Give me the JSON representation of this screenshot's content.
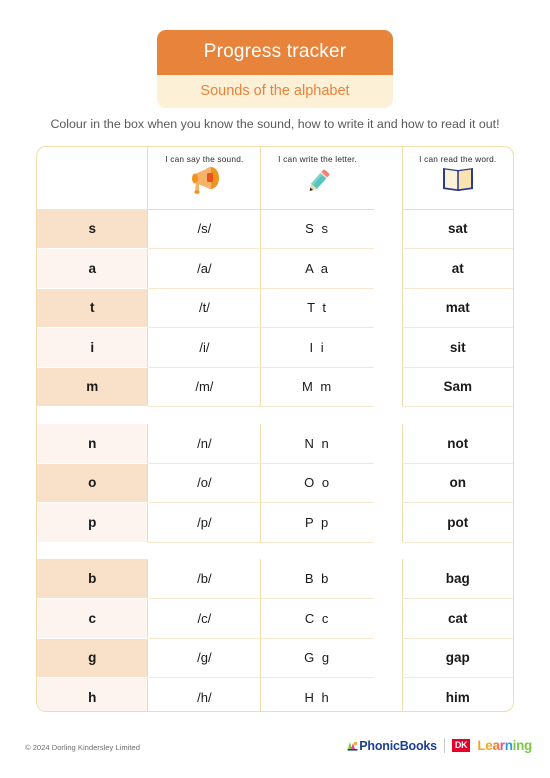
{
  "header": {
    "title": "Progress tracker",
    "subtitle": "Sounds of the alphabet",
    "title_bg": "#e8833c",
    "subtitle_bg": "#fcf0d7",
    "subtitle_color": "#e8833c"
  },
  "instruction": "Colour in the box when you know the sound, how to write it and how to read it out!",
  "table": {
    "columns": [
      {
        "key": "letter",
        "label": "",
        "icon": ""
      },
      {
        "key": "say",
        "label": "I can say the sound.",
        "icon": "megaphone-icon"
      },
      {
        "key": "write",
        "label": "I can write the letter.",
        "icon": "pencil-icon"
      },
      {
        "key": "read",
        "label": "I can read the word.",
        "icon": "open-book-icon"
      }
    ],
    "groups": [
      {
        "rows": [
          {
            "letter": "s",
            "say": "/s/",
            "write": "S s",
            "read": "sat"
          },
          {
            "letter": "a",
            "say": "/a/",
            "write": "A a",
            "read": "at"
          },
          {
            "letter": "t",
            "say": "/t/",
            "write": "T t",
            "read": "mat"
          },
          {
            "letter": "i",
            "say": "/i/",
            "write": "I i",
            "read": "sit"
          },
          {
            "letter": "m",
            "say": "/m/",
            "write": "M m",
            "read": "Sam"
          }
        ]
      },
      {
        "rows": [
          {
            "letter": "n",
            "say": "/n/",
            "write": "N n",
            "read": "not"
          },
          {
            "letter": "o",
            "say": "/o/",
            "write": "O o",
            "read": "on"
          },
          {
            "letter": "p",
            "say": "/p/",
            "write": "P p",
            "read": "pot"
          }
        ]
      },
      {
        "rows": [
          {
            "letter": "b",
            "say": "/b/",
            "write": "B b",
            "read": "bag"
          },
          {
            "letter": "c",
            "say": "/c/",
            "write": "C c",
            "read": "cat"
          },
          {
            "letter": "g",
            "say": "/g/",
            "write": "G g",
            "read": "gap"
          },
          {
            "letter": "h",
            "say": "/h/",
            "write": "H h",
            "read": "him"
          }
        ]
      }
    ],
    "border_color": "#f2dcae",
    "shade_dark": "#f8e0c9",
    "shade_light": "#fdf3ef"
  },
  "footer": {
    "copyright": "© 2024 Dorling Kindersley Limited",
    "phonicbooks_label": "PhonicBooks",
    "dk_badge": "DK",
    "learning_label": "Learning",
    "learning_letters": [
      {
        "ch": "L",
        "color": "#f5a623"
      },
      {
        "ch": "e",
        "color": "#f5a623"
      },
      {
        "ch": "a",
        "color": "#f07c35"
      },
      {
        "ch": "r",
        "color": "#ee4a8c"
      },
      {
        "ch": "n",
        "color": "#2a9fd6"
      },
      {
        "ch": "i",
        "color": "#7ac943"
      },
      {
        "ch": "n",
        "color": "#7ac943"
      },
      {
        "ch": "g",
        "color": "#7ac943"
      }
    ],
    "phonicbooks_color": "#1d3f94",
    "dk_red": "#e4002b"
  }
}
